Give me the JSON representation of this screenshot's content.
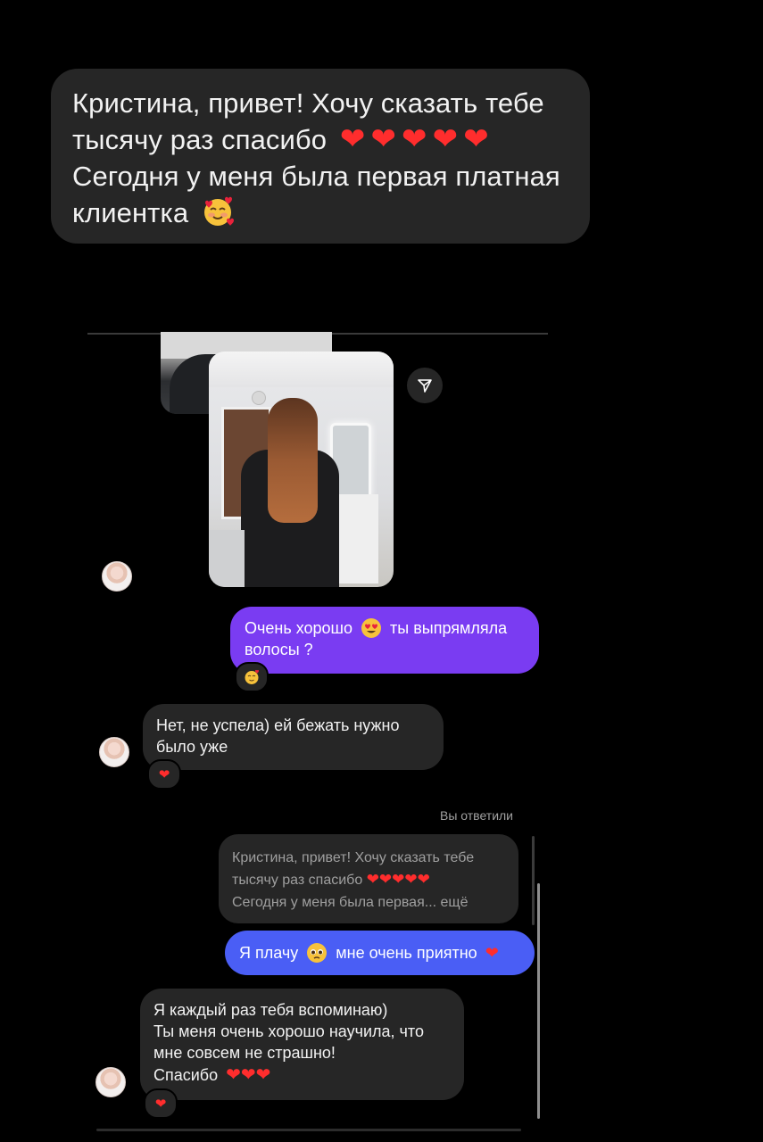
{
  "top_message": {
    "lines": [
      "Кристина, привет! Хочу сказать тебе",
      "тысячу раз спасибо",
      "Сегодня у меня была первая платная",
      "клиентка"
    ],
    "heart_count": 5,
    "emoji": "smiling-face-with-hearts"
  },
  "shared_post": {
    "share_icon": "send-icon"
  },
  "messages": {
    "outgoing_1": {
      "text_a": "Очень хорошо",
      "text_b": "ты выпрямляла",
      "text_c": "волосы ?",
      "reaction": "smiling-face-with-hearts"
    },
    "incoming_1": {
      "line1": "Нет, не успела) ей бежать нужно",
      "line2": "было уже",
      "reaction": "❤"
    },
    "replied_label": "Вы ответили",
    "quote": {
      "line1": "Кристина, привет! Хочу сказать тебе",
      "line2": "тысячу раз спасибо",
      "line3": "Сегодня у меня была первая... ещё"
    },
    "outgoing_2": {
      "text_a": "Я плачу",
      "text_b": "мне очень приятно",
      "heart": "❤"
    },
    "incoming_2": {
      "line1": "Я каждый раз тебя вспоминаю)",
      "line2": "Ты меня очень хорошо научила, что",
      "line3": "мне совсем не страшно!",
      "line4": "Спасибо",
      "reaction": "❤"
    }
  },
  "colors": {
    "background": "#000000",
    "bubble_dark": "#262626",
    "bubble_purple": "#7a3cf2",
    "bubble_blue": "#4a5ef5",
    "heart": "#ff2d2d"
  }
}
